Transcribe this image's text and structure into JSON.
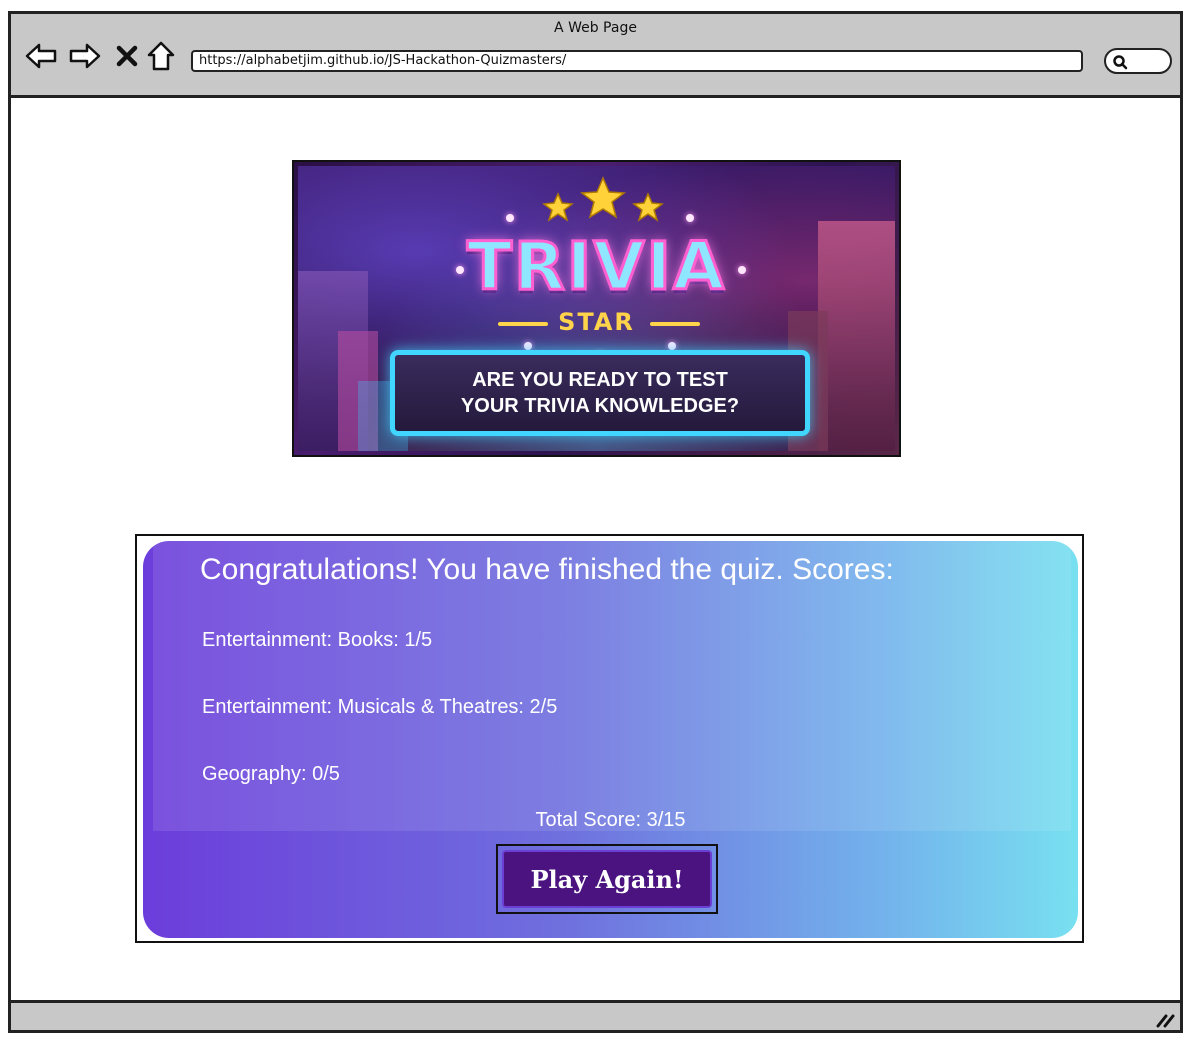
{
  "browser": {
    "window_title": "A Web Page",
    "url": "https://alphabetjim.github.io/JS-Hackathon-Quizmasters/",
    "nav_icons": [
      "back-arrow-icon",
      "forward-arrow-icon",
      "close-x-icon",
      "home-icon"
    ],
    "search_icon": "search-icon"
  },
  "banner": {
    "title": "TRIVIA",
    "subtitle": "STAR",
    "tagline_line1": "ARE YOU READY TO TEST",
    "tagline_line2": "YOUR TRIVIA KNOWLEDGE?"
  },
  "results": {
    "heading": "Congratulations! You have finished the quiz. Scores:",
    "scores": [
      "Entertainment: Books: 1/5",
      "Entertainment: Musicals & Theatres: 2/5",
      "Geography: 0/5"
    ],
    "total": "Total Score: 3/15",
    "play_again_label": "Play Again!"
  },
  "colors": {
    "card_gradient_start": "#6c3ddb",
    "card_gradient_end": "#78e0f0",
    "button_bg": "#4a1380"
  }
}
